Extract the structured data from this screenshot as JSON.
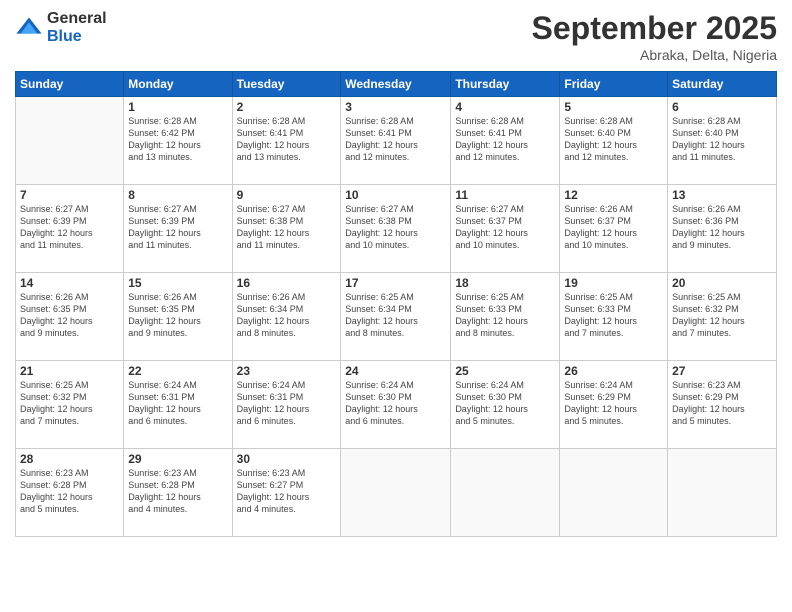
{
  "header": {
    "logo_general": "General",
    "logo_blue": "Blue",
    "month_title": "September 2025",
    "location": "Abraka, Delta, Nigeria"
  },
  "days_of_week": [
    "Sunday",
    "Monday",
    "Tuesday",
    "Wednesday",
    "Thursday",
    "Friday",
    "Saturday"
  ],
  "weeks": [
    [
      {
        "num": "",
        "info": ""
      },
      {
        "num": "1",
        "info": "Sunrise: 6:28 AM\nSunset: 6:42 PM\nDaylight: 12 hours\nand 13 minutes."
      },
      {
        "num": "2",
        "info": "Sunrise: 6:28 AM\nSunset: 6:41 PM\nDaylight: 12 hours\nand 13 minutes."
      },
      {
        "num": "3",
        "info": "Sunrise: 6:28 AM\nSunset: 6:41 PM\nDaylight: 12 hours\nand 12 minutes."
      },
      {
        "num": "4",
        "info": "Sunrise: 6:28 AM\nSunset: 6:41 PM\nDaylight: 12 hours\nand 12 minutes."
      },
      {
        "num": "5",
        "info": "Sunrise: 6:28 AM\nSunset: 6:40 PM\nDaylight: 12 hours\nand 12 minutes."
      },
      {
        "num": "6",
        "info": "Sunrise: 6:28 AM\nSunset: 6:40 PM\nDaylight: 12 hours\nand 11 minutes."
      }
    ],
    [
      {
        "num": "7",
        "info": "Sunrise: 6:27 AM\nSunset: 6:39 PM\nDaylight: 12 hours\nand 11 minutes."
      },
      {
        "num": "8",
        "info": "Sunrise: 6:27 AM\nSunset: 6:39 PM\nDaylight: 12 hours\nand 11 minutes."
      },
      {
        "num": "9",
        "info": "Sunrise: 6:27 AM\nSunset: 6:38 PM\nDaylight: 12 hours\nand 11 minutes."
      },
      {
        "num": "10",
        "info": "Sunrise: 6:27 AM\nSunset: 6:38 PM\nDaylight: 12 hours\nand 10 minutes."
      },
      {
        "num": "11",
        "info": "Sunrise: 6:27 AM\nSunset: 6:37 PM\nDaylight: 12 hours\nand 10 minutes."
      },
      {
        "num": "12",
        "info": "Sunrise: 6:26 AM\nSunset: 6:37 PM\nDaylight: 12 hours\nand 10 minutes."
      },
      {
        "num": "13",
        "info": "Sunrise: 6:26 AM\nSunset: 6:36 PM\nDaylight: 12 hours\nand 9 minutes."
      }
    ],
    [
      {
        "num": "14",
        "info": "Sunrise: 6:26 AM\nSunset: 6:35 PM\nDaylight: 12 hours\nand 9 minutes."
      },
      {
        "num": "15",
        "info": "Sunrise: 6:26 AM\nSunset: 6:35 PM\nDaylight: 12 hours\nand 9 minutes."
      },
      {
        "num": "16",
        "info": "Sunrise: 6:26 AM\nSunset: 6:34 PM\nDaylight: 12 hours\nand 8 minutes."
      },
      {
        "num": "17",
        "info": "Sunrise: 6:25 AM\nSunset: 6:34 PM\nDaylight: 12 hours\nand 8 minutes."
      },
      {
        "num": "18",
        "info": "Sunrise: 6:25 AM\nSunset: 6:33 PM\nDaylight: 12 hours\nand 8 minutes."
      },
      {
        "num": "19",
        "info": "Sunrise: 6:25 AM\nSunset: 6:33 PM\nDaylight: 12 hours\nand 7 minutes."
      },
      {
        "num": "20",
        "info": "Sunrise: 6:25 AM\nSunset: 6:32 PM\nDaylight: 12 hours\nand 7 minutes."
      }
    ],
    [
      {
        "num": "21",
        "info": "Sunrise: 6:25 AM\nSunset: 6:32 PM\nDaylight: 12 hours\nand 7 minutes."
      },
      {
        "num": "22",
        "info": "Sunrise: 6:24 AM\nSunset: 6:31 PM\nDaylight: 12 hours\nand 6 minutes."
      },
      {
        "num": "23",
        "info": "Sunrise: 6:24 AM\nSunset: 6:31 PM\nDaylight: 12 hours\nand 6 minutes."
      },
      {
        "num": "24",
        "info": "Sunrise: 6:24 AM\nSunset: 6:30 PM\nDaylight: 12 hours\nand 6 minutes."
      },
      {
        "num": "25",
        "info": "Sunrise: 6:24 AM\nSunset: 6:30 PM\nDaylight: 12 hours\nand 5 minutes."
      },
      {
        "num": "26",
        "info": "Sunrise: 6:24 AM\nSunset: 6:29 PM\nDaylight: 12 hours\nand 5 minutes."
      },
      {
        "num": "27",
        "info": "Sunrise: 6:23 AM\nSunset: 6:29 PM\nDaylight: 12 hours\nand 5 minutes."
      }
    ],
    [
      {
        "num": "28",
        "info": "Sunrise: 6:23 AM\nSunset: 6:28 PM\nDaylight: 12 hours\nand 5 minutes."
      },
      {
        "num": "29",
        "info": "Sunrise: 6:23 AM\nSunset: 6:28 PM\nDaylight: 12 hours\nand 4 minutes."
      },
      {
        "num": "30",
        "info": "Sunrise: 6:23 AM\nSunset: 6:27 PM\nDaylight: 12 hours\nand 4 minutes."
      },
      {
        "num": "",
        "info": ""
      },
      {
        "num": "",
        "info": ""
      },
      {
        "num": "",
        "info": ""
      },
      {
        "num": "",
        "info": ""
      }
    ]
  ]
}
